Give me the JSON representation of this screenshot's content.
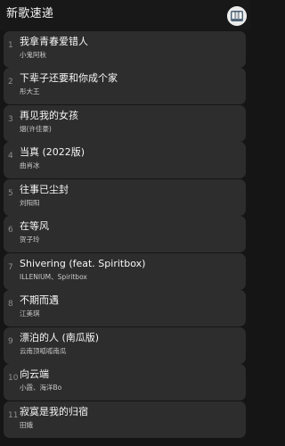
{
  "header": {
    "title": "新歌速递",
    "button_icon": "music-card-icon"
  },
  "colors": {
    "background": "#151515",
    "row_background": "#2d2d2d",
    "title_text": "#f6f6f6",
    "artist_text": "#c9c9c9",
    "index_text": "#8e8e8e"
  },
  "songs": [
    {
      "index": "1",
      "title": "我拿青春爱错人",
      "artist": "小鬼阿秋"
    },
    {
      "index": "2",
      "title": "下辈子还要和你成个家",
      "artist": "彤大王"
    },
    {
      "index": "3",
      "title": "再见我的女孩",
      "artist": "烟(许佳豪)"
    },
    {
      "index": "4",
      "title": "当真 (2022版)",
      "artist": "曲肖冰"
    },
    {
      "index": "5",
      "title": "往事已尘封",
      "artist": "刘阳阳"
    },
    {
      "index": "6",
      "title": "在等风",
      "artist": "贺子玲"
    },
    {
      "index": "7",
      "title": "Shivering (feat. Spiritbox)",
      "artist": "ILLENIUM、Spiritbox"
    },
    {
      "index": "8",
      "title": "不期而遇",
      "artist": "江美琪"
    },
    {
      "index": "9",
      "title": "漂泊的人 (南瓜版)",
      "artist": "云南顶呱呱南瓜"
    },
    {
      "index": "10",
      "title": "向云端",
      "artist": "小霞、海洋Bo"
    },
    {
      "index": "11",
      "title": "寂寞是我的归宿",
      "artist": "田娥"
    }
  ]
}
